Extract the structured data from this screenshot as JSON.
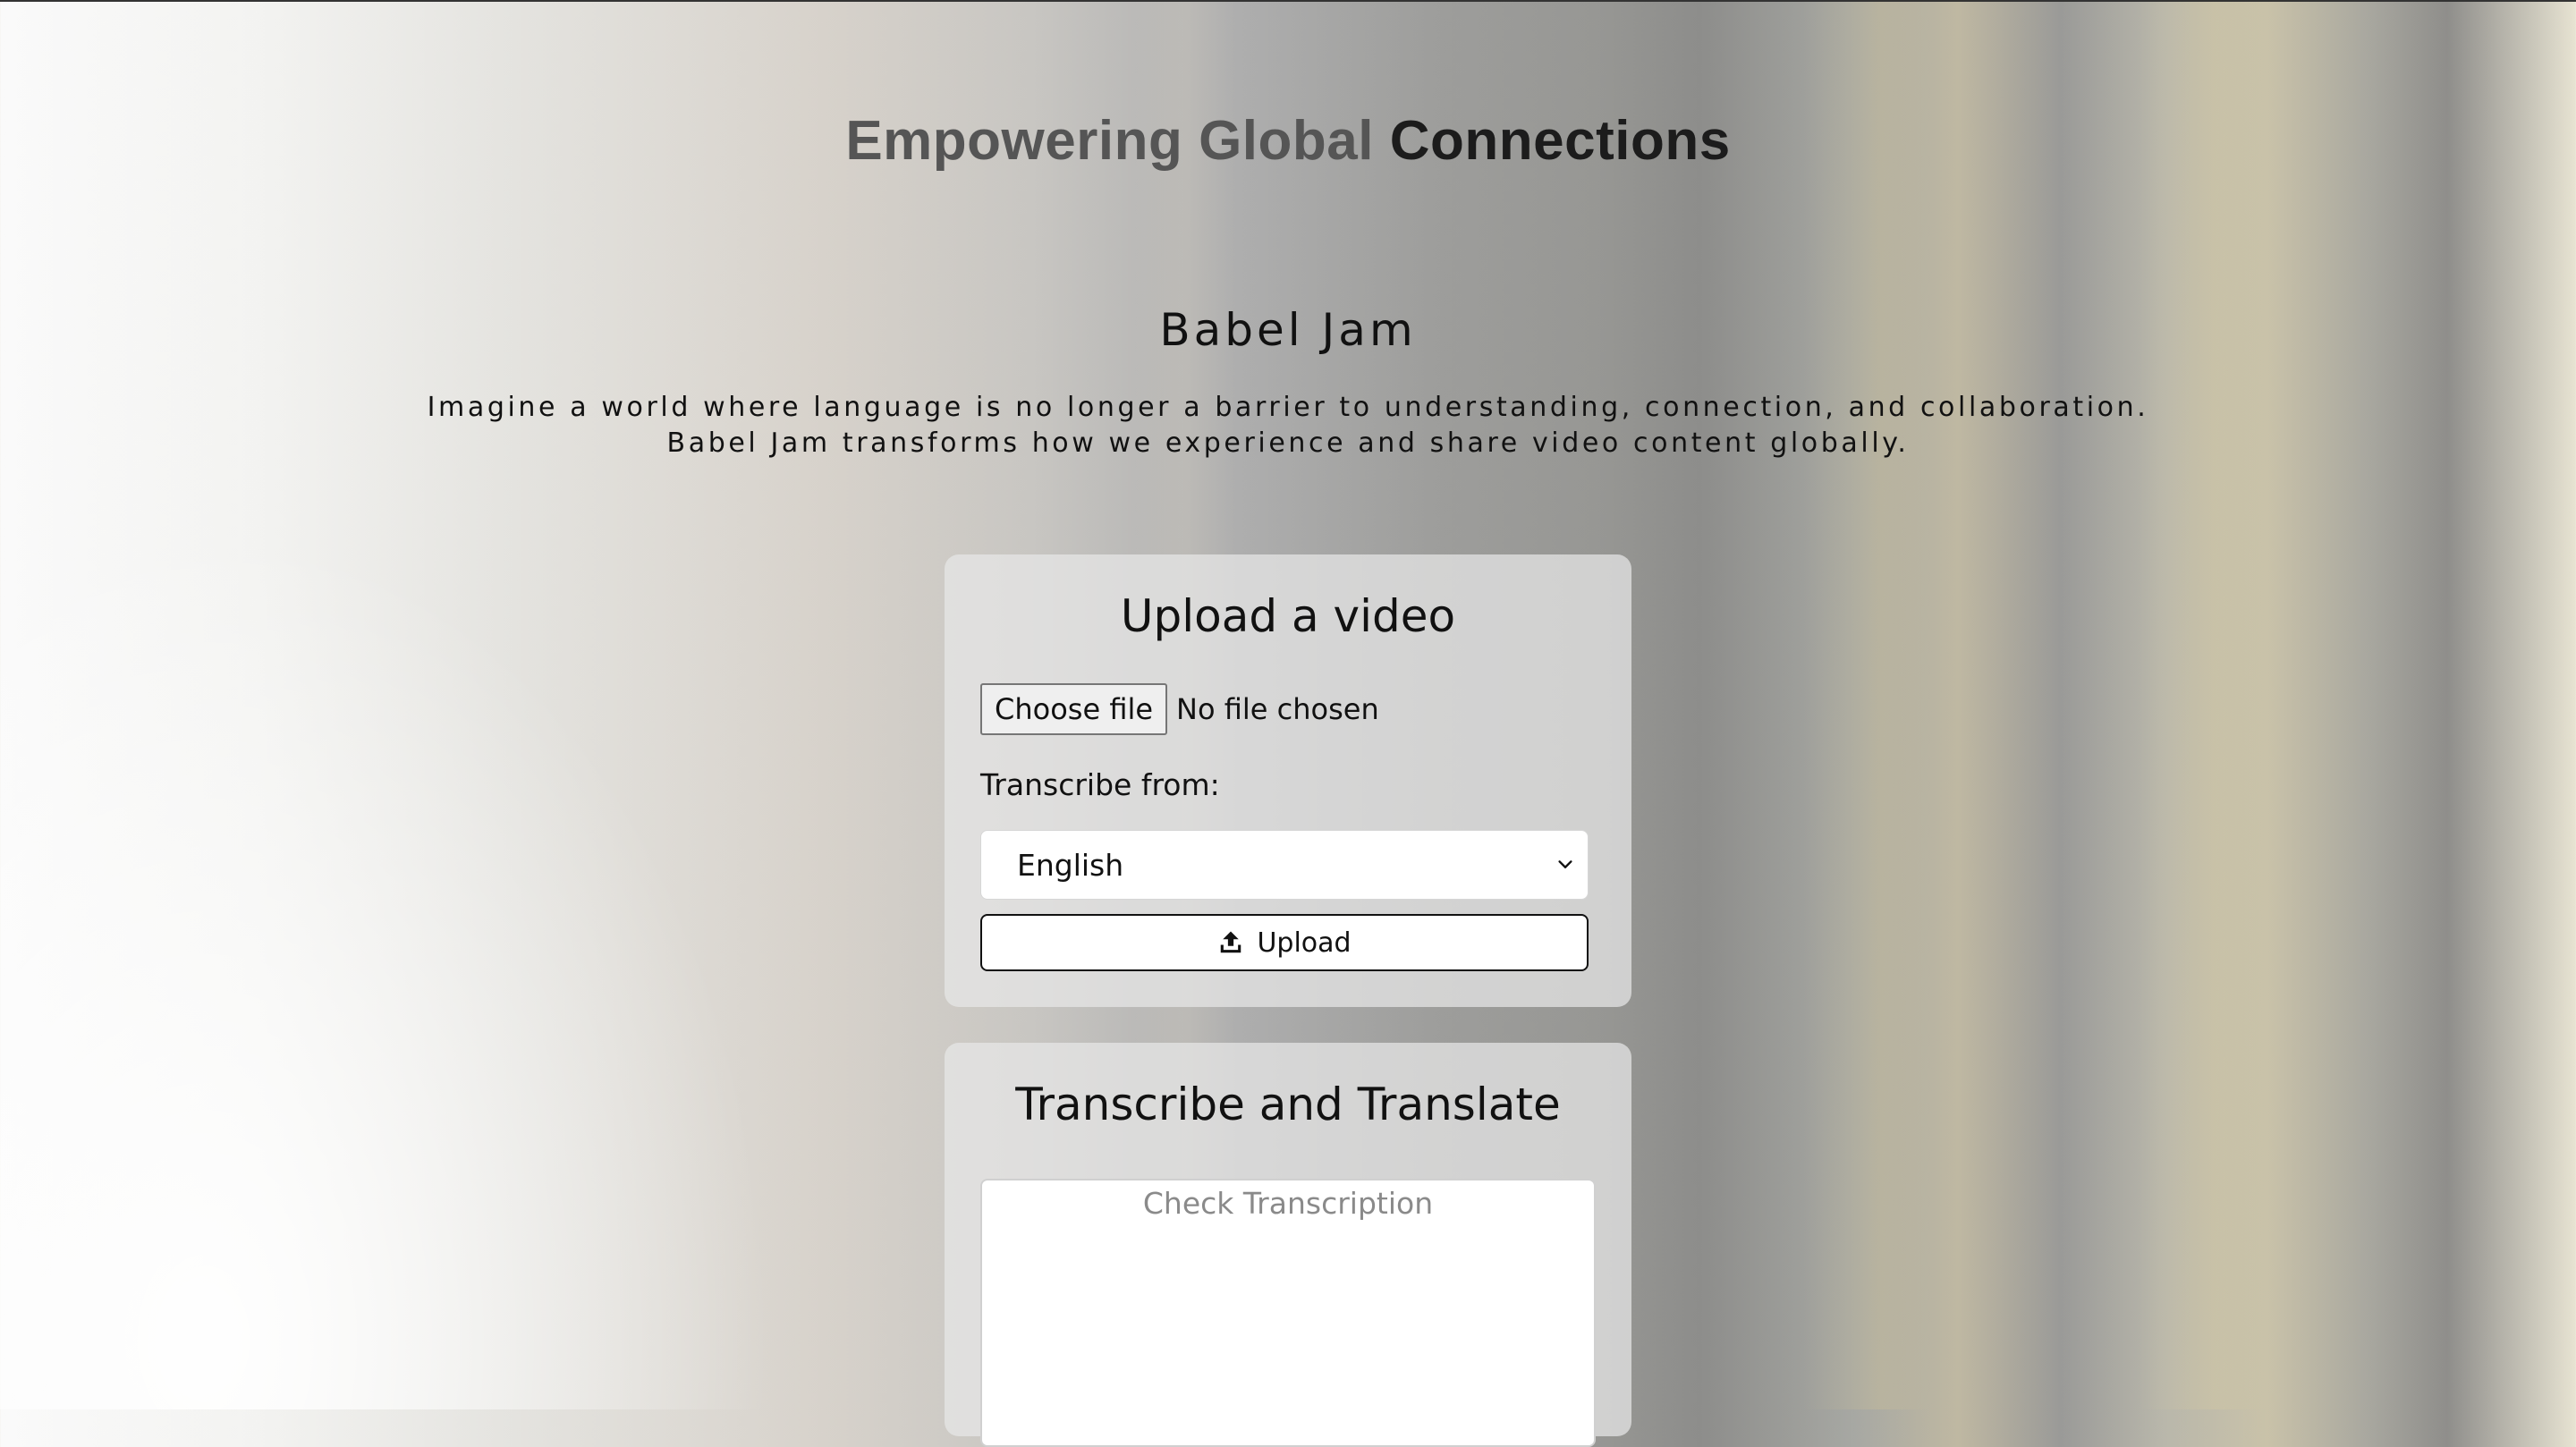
{
  "hero": {
    "title_muted": "Empowering Global",
    "title_strong": "Connections"
  },
  "brand": {
    "name": "Babel Jam"
  },
  "tagline": {
    "line1": "Imagine a world where language is no longer a barrier to understanding, connection, and collaboration.",
    "line2": "Babel Jam transforms how we experience and share video content globally."
  },
  "upload_card": {
    "title": "Upload a video",
    "choose_file_label": "Choose file",
    "file_status": "No file chosen",
    "transcribe_from_label": "Transcribe from:",
    "selected_language": "English",
    "upload_label": "Upload",
    "icons": {
      "upload": "upload-icon",
      "dropdown": "chevron-down-icon"
    }
  },
  "transcribe_card": {
    "title": "Transcribe and Translate",
    "transcription_placeholder": "Check Transcription"
  }
}
